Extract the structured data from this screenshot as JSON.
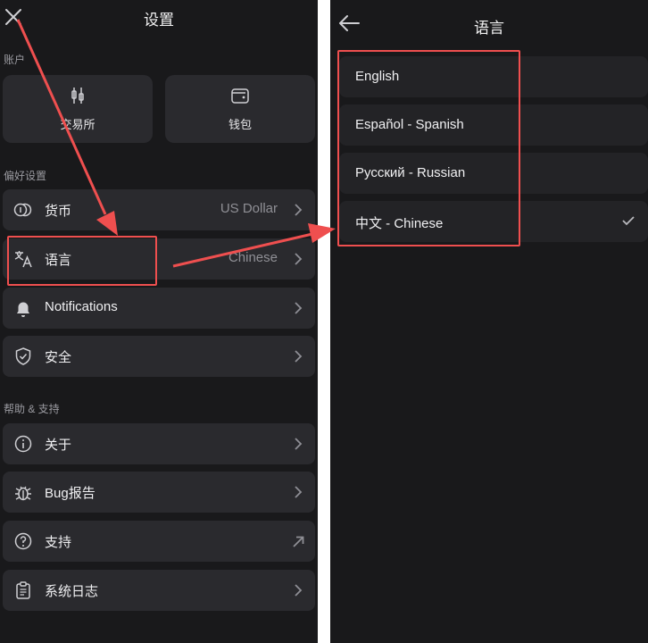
{
  "settings": {
    "title": "设置",
    "account_section": "账户",
    "tiles": [
      {
        "label": "交易所",
        "icon": "candlestick-icon"
      },
      {
        "label": "钱包",
        "icon": "wallet-icon"
      }
    ],
    "preferences_section": "偏好设置",
    "preferences": [
      {
        "label": "货币",
        "value": "US Dollar",
        "icon": "currency-icon"
      },
      {
        "label": "语言",
        "value": "Chinese",
        "icon": "translate-icon"
      },
      {
        "label": "Notifications",
        "value": "",
        "icon": "bell-icon"
      },
      {
        "label": "安全",
        "value": "",
        "icon": "shield-icon"
      }
    ],
    "help_section": "帮助 & 支持",
    "help": [
      {
        "label": "关于",
        "icon": "info-icon"
      },
      {
        "label": "Bug报告",
        "icon": "bug-icon"
      },
      {
        "label": "支持",
        "icon": "help-icon"
      },
      {
        "label": "系统日志",
        "icon": "clipboard-icon"
      }
    ]
  },
  "language": {
    "title": "语言",
    "options": [
      {
        "label": "English",
        "selected": false
      },
      {
        "label": "Español - Spanish",
        "selected": false
      },
      {
        "label": "Русский - Russian",
        "selected": false
      },
      {
        "label": "中文 - Chinese",
        "selected": true
      }
    ]
  },
  "colors": {
    "background": "#19191b",
    "card": "#2a2a2e",
    "highlight": "#ef4f4f",
    "text": "#f0f0f2",
    "muted": "#8f8f95"
  }
}
